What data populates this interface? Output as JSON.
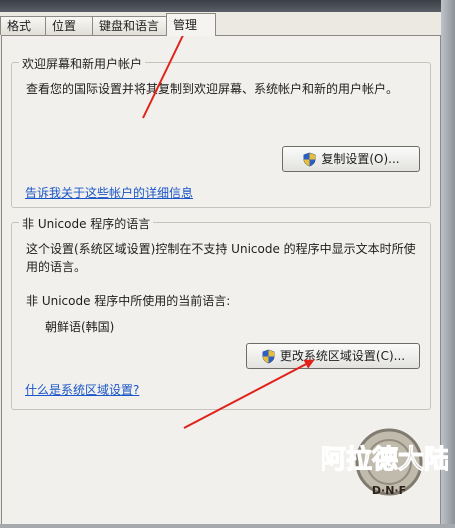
{
  "tabs": [
    {
      "label": "格式"
    },
    {
      "label": "位置"
    },
    {
      "label": "键盘和语言"
    },
    {
      "label": "管理"
    }
  ],
  "welcome": {
    "title": "欢迎屏幕和新用户帐户",
    "desc": "查看您的国际设置并将其复制到欢迎屏幕、系统帐户和新的用户帐户。",
    "copy_button": "复制设置(O)...",
    "link": "告诉我关于这些帐户的详细信息"
  },
  "nonunicode": {
    "title": "非 Unicode 程序的语言",
    "desc": "这个设置(系统区域设置)控制在不支持 Unicode 的程序中显示文本时所使用的语言。",
    "current_label": "非 Unicode 程序中所使用的当前语言:",
    "current_value": "朝鲜语(韩国)",
    "change_button": "更改系统区域设置(C)...",
    "link": "什么是系统区域设置?"
  },
  "watermark": {
    "text": "阿拉德大陆",
    "sub": "D·N·F"
  },
  "colors": {
    "link": "#1a56c8",
    "arrow": "#e0221a",
    "shield_blue": "#2b5fc4",
    "shield_yellow": "#f2c230"
  }
}
